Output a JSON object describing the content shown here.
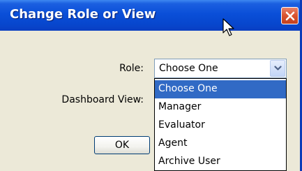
{
  "window": {
    "title": "Change Role or View"
  },
  "form": {
    "role_label": "Role:",
    "dashboard_view_label": "Dashboard View:",
    "role_select": {
      "value": "Choose One",
      "options": [
        "Choose One",
        "Manager",
        "Evaluator",
        "Agent",
        "Archive User"
      ],
      "highlighted_option": "Choose One"
    }
  },
  "buttons": {
    "ok_label": "OK"
  },
  "icons": {
    "close": "close-icon",
    "dropdown_arrow": "chevron-down-icon",
    "cursor": "mouse-cursor-icon"
  },
  "colors": {
    "titlebar": "#0a4fd8",
    "dialog_background": "#ece9d8",
    "selection_highlight": "#316ac5",
    "close_button": "#d9532f"
  }
}
